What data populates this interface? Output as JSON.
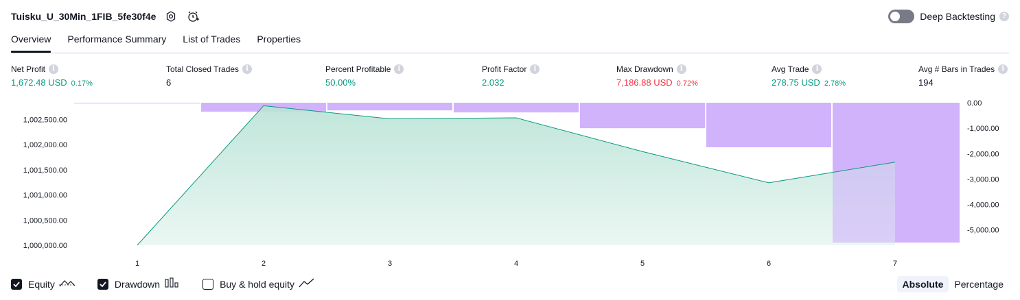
{
  "header": {
    "strategy_name": "Tuisku_U_30Min_1FIB_5fe30f4e",
    "deep_backtesting_label": "Deep Backtesting",
    "help_glyph": "?",
    "icons": [
      "settings-icon",
      "add-alert-icon",
      "help-icon"
    ]
  },
  "tabs": [
    {
      "label": "Overview",
      "active": true
    },
    {
      "label": "Performance Summary",
      "active": false
    },
    {
      "label": "List of Trades",
      "active": false
    },
    {
      "label": "Properties",
      "active": false
    }
  ],
  "stats": [
    {
      "label": "Net Profit",
      "value": "1,672.48 USD",
      "pct": "0.17%",
      "color": "#089981"
    },
    {
      "label": "Total Closed Trades",
      "value": "6",
      "pct": "",
      "color": "#131722"
    },
    {
      "label": "Percent Profitable",
      "value": "50.00%",
      "pct": "",
      "color": "#089981"
    },
    {
      "label": "Profit Factor",
      "value": "2.032",
      "pct": "",
      "color": "#089981"
    },
    {
      "label": "Max Drawdown",
      "value": "7,186.88 USD",
      "pct": "0.72%",
      "color": "#f23645"
    },
    {
      "label": "Avg Trade",
      "value": "278.75 USD",
      "pct": "2.78%",
      "color": "#089981"
    },
    {
      "label": "Avg # Bars in Trades",
      "value": "194",
      "pct": "",
      "color": "#131722"
    }
  ],
  "info_glyph": "i",
  "chart_data": {
    "type": "area",
    "x": [
      1,
      2,
      3,
      4,
      5,
      6,
      7
    ],
    "equity": {
      "values": [
        1000000,
        1002770,
        1002510,
        1002530,
        1001860,
        1001240,
        1001650
      ],
      "ticks": [
        "1,000,000.00",
        "1,000,500.00",
        "1,001,000.00",
        "1,001,500.00",
        "1,002,000.00",
        "1,002,500.00"
      ],
      "tick_values": [
        1000000,
        1000500,
        1001000,
        1001500,
        1002000,
        1002500
      ],
      "color": "#089981",
      "fill": "#c8e8df"
    },
    "drawdown": {
      "values": [
        -20,
        -350,
        -300,
        -380,
        -1000,
        -1750,
        -5500
      ],
      "ticks": [
        "0.00",
        "-1,000.00",
        "-2,000.00",
        "-3,000.00",
        "-4,000.00",
        "-5,000.00"
      ],
      "tick_values": [
        0,
        -1000,
        -2000,
        -3000,
        -4000,
        -5000
      ],
      "color": "#d1b3fb",
      "edge_color": "#ce93d8"
    },
    "x_tick_labels": [
      "1",
      "2",
      "3",
      "4",
      "5",
      "6",
      "7"
    ]
  },
  "legend": [
    {
      "label": "Equity",
      "checked": true,
      "icon": "equity-line-icon"
    },
    {
      "label": "Drawdown",
      "checked": true,
      "icon": "drawdown-bars-icon"
    },
    {
      "label": "Buy & hold equity",
      "checked": false,
      "icon": "buy-hold-line-icon"
    }
  ],
  "modes": [
    {
      "label": "Absolute",
      "active": true
    },
    {
      "label": "Percentage",
      "active": false
    }
  ]
}
